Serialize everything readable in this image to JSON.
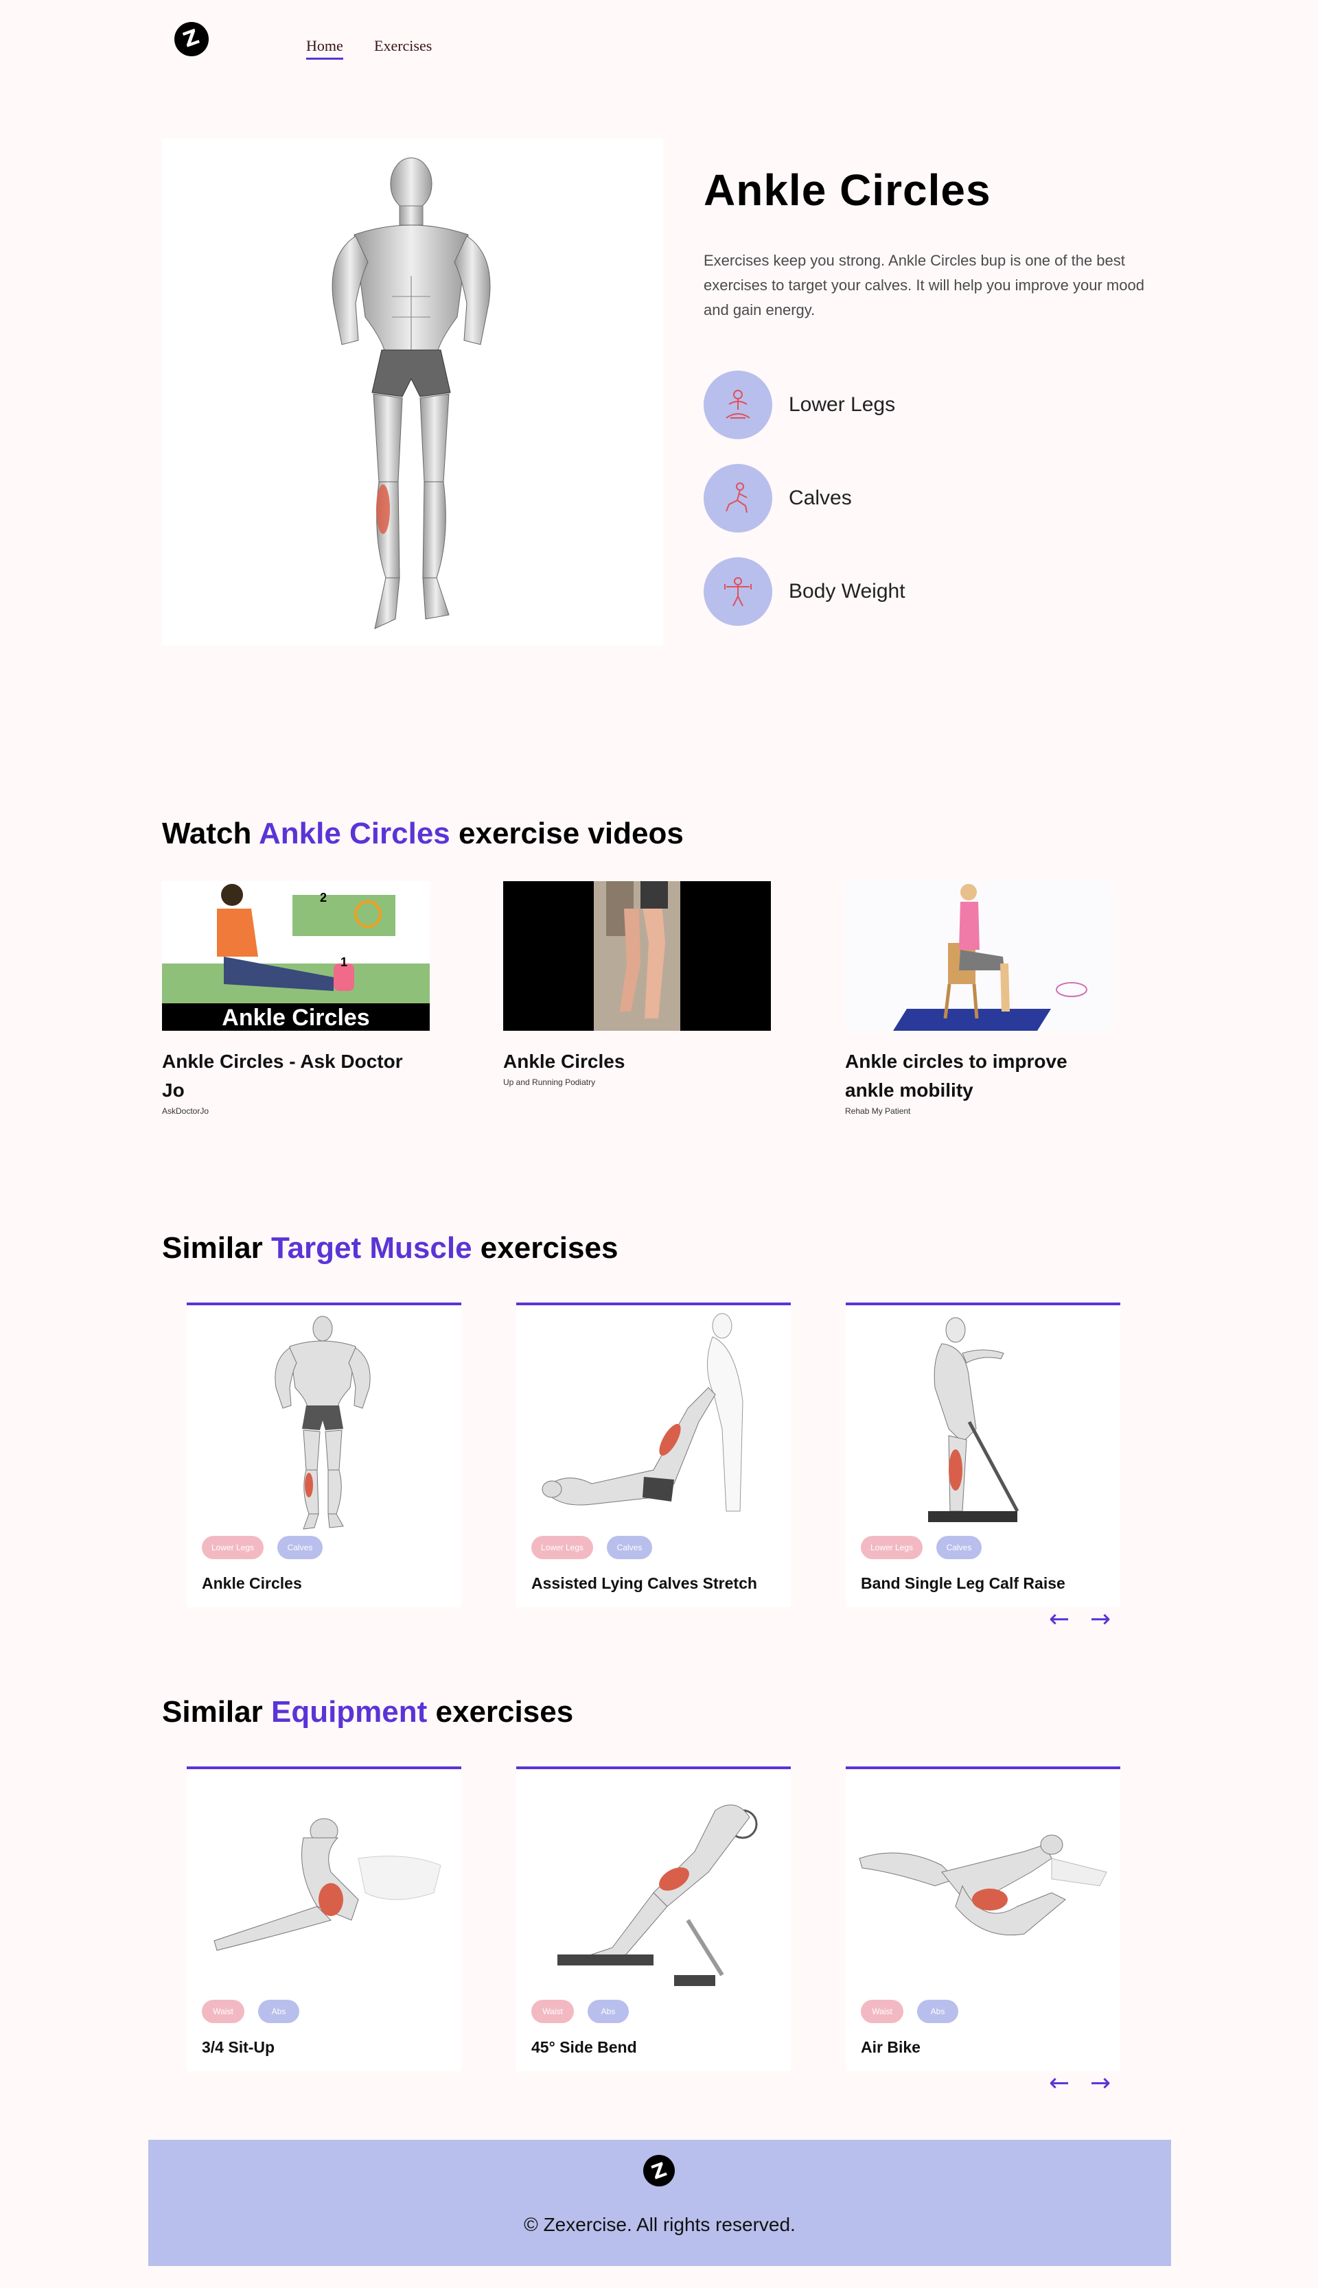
{
  "nav": {
    "logo_icon": "zexercise-logo-icon",
    "links": [
      "Home",
      "Exercises"
    ],
    "active": "Home"
  },
  "hero": {
    "title": "Ankle Circles",
    "description_line1": "Exercises keep you strong. Ankle Circles bup is one of the best",
    "description_line2": "exercises to target your calves. It will help you improve your mood and gain energy.",
    "badges": [
      {
        "label": "Lower Legs",
        "icon": "body-part-icon"
      },
      {
        "label": "Calves",
        "icon": "target-muscle-icon"
      },
      {
        "label": "Body Weight",
        "icon": "equipment-icon"
      }
    ]
  },
  "videos_section": {
    "prefix": "Watch ",
    "accent": "Ankle Circles",
    "suffix": " exercise videos",
    "videos": [
      {
        "title": "Ankle Circles - Ask Doctor Jo",
        "channel": "AskDoctorJo",
        "thumb_text": "Ankle Circles"
      },
      {
        "title": "Ankle Circles",
        "channel": "Up and Running Podiatry"
      },
      {
        "title": "Ankle circles to improve ankle mobility",
        "channel": "Rehab My Patient"
      }
    ]
  },
  "target_section": {
    "prefix": "Similar ",
    "accent": "Target Muscle",
    "suffix": " exercises",
    "cards": [
      {
        "title": "Ankle Circles",
        "tag1": "Lower Legs",
        "tag2": "Calves"
      },
      {
        "title": "Assisted Lying Calves Stretch",
        "tag1": "Lower Legs",
        "tag2": "Calves"
      },
      {
        "title": "Band Single Leg Calf Raise",
        "tag1": "Lower Legs",
        "tag2": "Calves"
      }
    ],
    "prev_arrow": "←",
    "next_arrow": "→"
  },
  "equipment_section": {
    "prefix": "Similar ",
    "accent": "Equipment",
    "suffix": " exercises",
    "cards": [
      {
        "title": "3/4 Sit-Up",
        "tag1": "Waist",
        "tag2": "Abs"
      },
      {
        "title": "45° Side Bend",
        "tag1": "Waist",
        "tag2": "Abs"
      },
      {
        "title": "Air Bike",
        "tag1": "Waist",
        "tag2": "Abs"
      }
    ],
    "prev_arrow": "←",
    "next_arrow": "→"
  },
  "footer": {
    "text": "© Zexercise. All rights reserved."
  },
  "colors": {
    "accent": "#5a34d6",
    "badge_bg": "#b8bfec",
    "tag_pink": "#f3b9c2",
    "page_bg": "#fff9fa"
  }
}
